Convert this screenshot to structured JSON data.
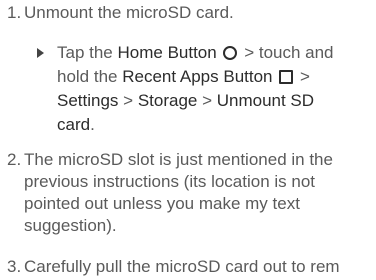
{
  "steps": [
    {
      "number": "1.",
      "text": "Unmount the microSD card.",
      "substep": {
        "line1": {
          "pre": "Tap the ",
          "home_button": "Home Button",
          "mid": " > touch and",
          "icon": "home-circle-icon"
        },
        "line2": {
          "pre": "hold the ",
          "recent_apps_button": "Recent Apps Button",
          "post": " >",
          "icon": "recent-apps-square-icon"
        },
        "line3": {
          "settings": "Settings",
          "sep1": " > ",
          "storage": "Storage",
          "sep2": " > ",
          "unmount": "Unmount SD"
        },
        "line4": {
          "card": "card",
          "end": "."
        }
      }
    },
    {
      "number": "2.",
      "lines": [
        "The microSD slot is just mentioned in the",
        "previous instructions (its location is not",
        "pointed out unless you make my text",
        "suggestion)."
      ]
    },
    {
      "number": "3.",
      "text": "Carefully pull the microSD card out to rem"
    }
  ]
}
